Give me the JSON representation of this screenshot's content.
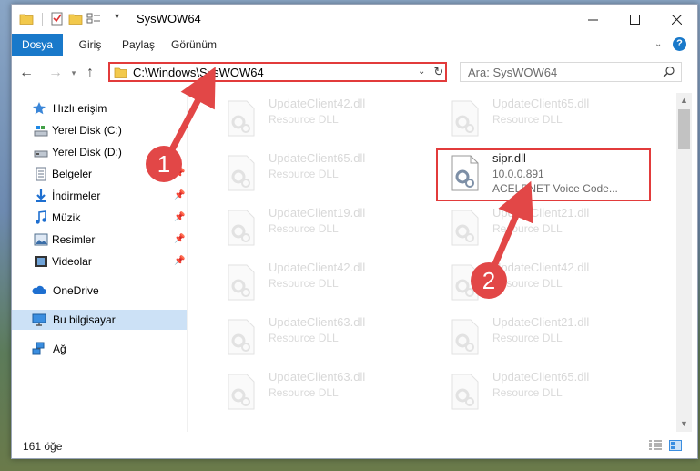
{
  "window": {
    "title": "SysWOW64"
  },
  "ribbon": {
    "tabs": [
      "Dosya",
      "Giriş",
      "Paylaş",
      "Görünüm"
    ],
    "help_label": "?"
  },
  "navigation": {
    "address": "C:\\Windows\\SysWOW64",
    "search_placeholder": "Ara: SysWOW64"
  },
  "sidebar": {
    "quick_access": "Hızlı erişim",
    "items": [
      {
        "label": "Yerel Disk (C:)",
        "icon": "drive-icon"
      },
      {
        "label": "Yerel Disk (D:)",
        "icon": "drive-icon"
      },
      {
        "label": "Belgeler",
        "icon": "documents-icon"
      },
      {
        "label": "İndirmeler",
        "icon": "downloads-icon"
      },
      {
        "label": "Müzik",
        "icon": "music-icon"
      },
      {
        "label": "Resimler",
        "icon": "pictures-icon"
      },
      {
        "label": "Videolar",
        "icon": "videos-icon"
      }
    ],
    "onedrive": "OneDrive",
    "this_pc": "Bu bilgisayar",
    "network": "Ağ"
  },
  "files": [
    {
      "name": "UpdateClient42.dll",
      "desc": "Resource DLL"
    },
    {
      "name": "UpdateClient65.dll",
      "desc": "Resource DLL"
    },
    {
      "name": "UpdateClient65.dll",
      "desc": "Resource DLL"
    },
    {
      "name": "sipr.dll",
      "desc": "10.0.0.891",
      "desc2": "ACELPNET Voice Code..."
    },
    {
      "name": "UpdateClient19.dll",
      "desc": "Resource DLL"
    },
    {
      "name": "UpdateClient21.dll",
      "desc": "Resource DLL"
    },
    {
      "name": "UpdateClient42.dll",
      "desc": "Resource DLL"
    },
    {
      "name": "UpdateClient42.dll",
      "desc": "Resource DLL"
    },
    {
      "name": "UpdateClient63.dll",
      "desc": "Resource DLL"
    },
    {
      "name": "UpdateClient21.dll",
      "desc": "Resource DLL"
    },
    {
      "name": "UpdateClient63.dll",
      "desc": "Resource DLL"
    },
    {
      "name": "UpdateClient65.dll",
      "desc": "Resource DLL"
    }
  ],
  "status": {
    "count": "161 öğe"
  },
  "callouts": [
    "1",
    "2"
  ],
  "colors": {
    "accent": "#1979ca",
    "highlight": "#e23b3b",
    "callout": "#e24747",
    "selected": "#cce1f6"
  }
}
